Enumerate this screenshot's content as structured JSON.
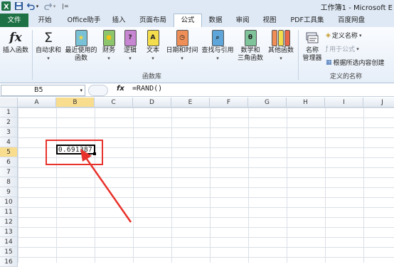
{
  "window": {
    "title": "工作簿1 - Microsoft E"
  },
  "quick_access": {
    "icons": [
      "excel-logo-icon",
      "save-icon",
      "undo-icon",
      "redo-icon",
      "customize-icon"
    ],
    "undo_caret": "▾",
    "redo_caret": "▾",
    "customize_glyph": "|="
  },
  "tabs": [
    {
      "label": "文件"
    },
    {
      "label": "开始"
    },
    {
      "label": "Office助手"
    },
    {
      "label": "插入"
    },
    {
      "label": "页面布局"
    },
    {
      "label": "公式"
    },
    {
      "label": "数据"
    },
    {
      "label": "审阅"
    },
    {
      "label": "视图"
    },
    {
      "label": "PDF工具集"
    },
    {
      "label": "百度网盘"
    }
  ],
  "ribbon": {
    "insert_function": {
      "label": "插入函数",
      "glyph": "fx"
    },
    "autosum": {
      "label": "自动求和",
      "glyph": "Σ"
    },
    "recent": {
      "line1": "最近使用的",
      "line2": "函数"
    },
    "financial": {
      "label": "财务"
    },
    "logical": {
      "label": "逻辑",
      "glyph": "?"
    },
    "text": {
      "label": "文本",
      "glyph": "A"
    },
    "datetime": {
      "label": "日期和时间"
    },
    "lookup": {
      "label": "查找与引用"
    },
    "math": {
      "line1": "数学和",
      "line2": "三角函数",
      "glyph": "θ"
    },
    "more": {
      "label": "其他函数"
    },
    "group_library": "函数库",
    "name_manager": {
      "line1": "名称",
      "line2": "管理器"
    },
    "define_name": "定义名称",
    "use_in_formula": "用于公式",
    "create_from_selection": "根据所选内容创建",
    "group_names": "定义的名称",
    "dropdown_caret": "▾"
  },
  "formula_bar": {
    "name_box": "B5",
    "fx": "fx",
    "formula": "=RAND()"
  },
  "sheet": {
    "columns": [
      "A",
      "B",
      "C",
      "D",
      "E",
      "F",
      "G",
      "H",
      "I",
      "J"
    ],
    "rows": [
      "1",
      "2",
      "3",
      "4",
      "5",
      "6",
      "7",
      "8",
      "9",
      "10",
      "11",
      "12",
      "13",
      "14",
      "15",
      "16"
    ],
    "selected_cell": "B5",
    "selected_value": "0.691387"
  },
  "colors": {
    "file_tab": "#1e7145",
    "selection_header": "#f9dd8f",
    "annotation": "#e8312a"
  }
}
